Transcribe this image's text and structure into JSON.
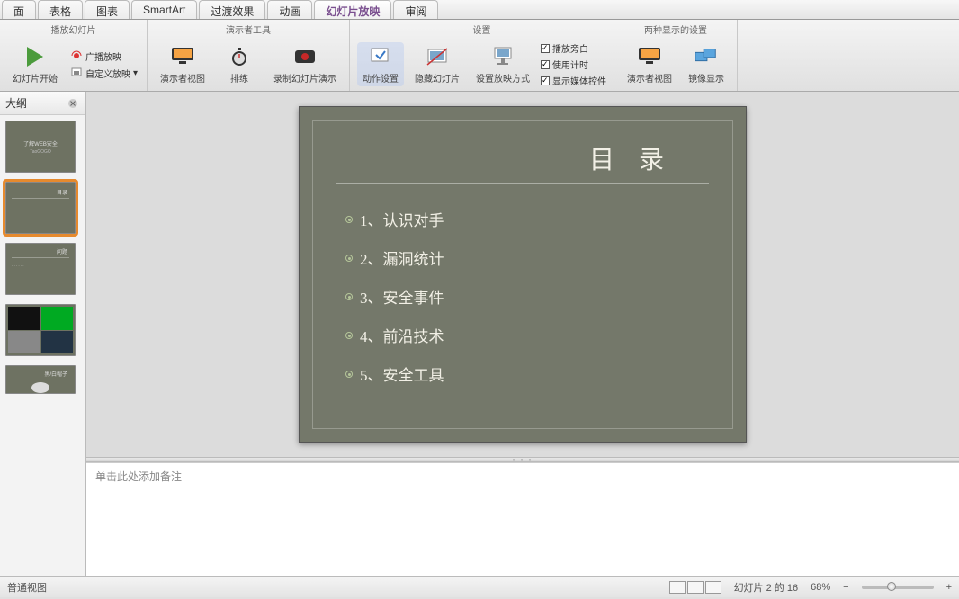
{
  "tabs": {
    "items": [
      "面",
      "表格",
      "图表",
      "SmartArt",
      "过渡效果",
      "动画",
      "幻灯片放映",
      "审阅"
    ],
    "active": 6
  },
  "ribbon": {
    "group1": {
      "label": "播放幻灯片",
      "btn_start": "幻灯片开始",
      "mini_broadcast": "广播放映",
      "mini_custom": "自定义放映"
    },
    "group2": {
      "label": "演示者工具",
      "btn_presenter": "演示者视图",
      "btn_rehearse": "排练",
      "btn_record": "录制幻灯片演示"
    },
    "group3": {
      "label": "设置",
      "btn_action": "动作设置",
      "btn_hide": "隐藏幻灯片",
      "btn_setup": "设置放映方式",
      "chk_narration": "播放旁白",
      "chk_timing": "使用计时",
      "chk_media": "显示媒体控件"
    },
    "group4": {
      "label": "两种显示的设置",
      "btn_presenter2": "演示者视图",
      "btn_mirror": "镜像显示"
    }
  },
  "thumbs": {
    "tab_label": "大纲",
    "slide1_title": "了解WEB安全",
    "slide1_sub": "TaoGOGO",
    "slide2_title": "目录",
    "slide3_title": "问题",
    "slide5_title": "黑/白帽子"
  },
  "slide": {
    "title": "目 录",
    "items": [
      "1、认识对手",
      "2、漏洞统计",
      "3、安全事件",
      "4、前沿技术",
      "5、安全工具"
    ]
  },
  "notes": {
    "placeholder": "单击此处添加备注"
  },
  "status": {
    "view_mode": "普通视图",
    "slide_info": "幻灯片 2 的 16",
    "zoom": "68%"
  }
}
